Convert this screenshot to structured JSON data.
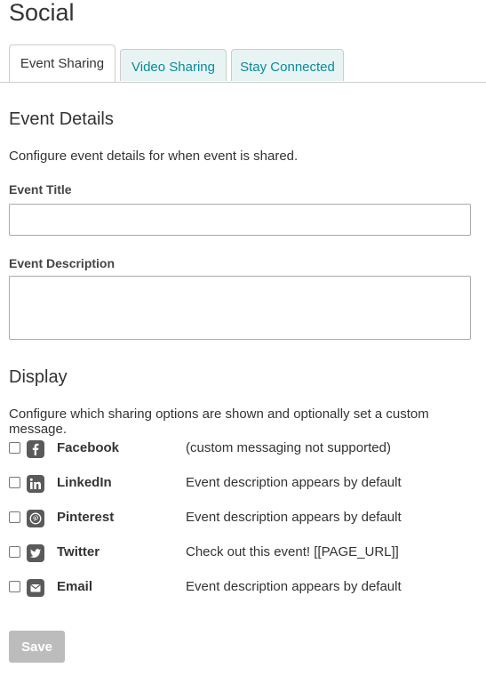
{
  "page": {
    "title": "Social"
  },
  "tabs": [
    {
      "label": "Event Sharing",
      "active": true
    },
    {
      "label": "Video Sharing",
      "active": false
    },
    {
      "label": "Stay Connected",
      "active": false
    }
  ],
  "event_details": {
    "heading": "Event Details",
    "description": "Configure event details for when event is shared.",
    "title_label": "Event Title",
    "title_value": "",
    "description_label": "Event Description",
    "description_value": ""
  },
  "display": {
    "heading": "Display",
    "description": "Configure which sharing options are shown and optionally set a custom message.",
    "options": [
      {
        "name": "Facebook",
        "icon": "facebook-icon",
        "message": "(custom messaging not supported)",
        "checked": false
      },
      {
        "name": "LinkedIn",
        "icon": "linkedin-icon",
        "message": "Event description appears by default",
        "checked": false
      },
      {
        "name": "Pinterest",
        "icon": "pinterest-icon",
        "message": "Event description appears by default",
        "checked": false
      },
      {
        "name": "Twitter",
        "icon": "twitter-icon",
        "message": "Check out this event! [[PAGE_URL]]",
        "checked": false
      },
      {
        "name": "Email",
        "icon": "email-icon",
        "message": "Event description appears by default",
        "checked": false
      }
    ]
  },
  "actions": {
    "save_label": "Save"
  },
  "colors": {
    "tab_link": "#0a8a9a",
    "tab_inactive_bg": "#e8f4f4",
    "save_disabled_bg": "#bcbcbc",
    "icon_bg": "#5a5a5a"
  }
}
